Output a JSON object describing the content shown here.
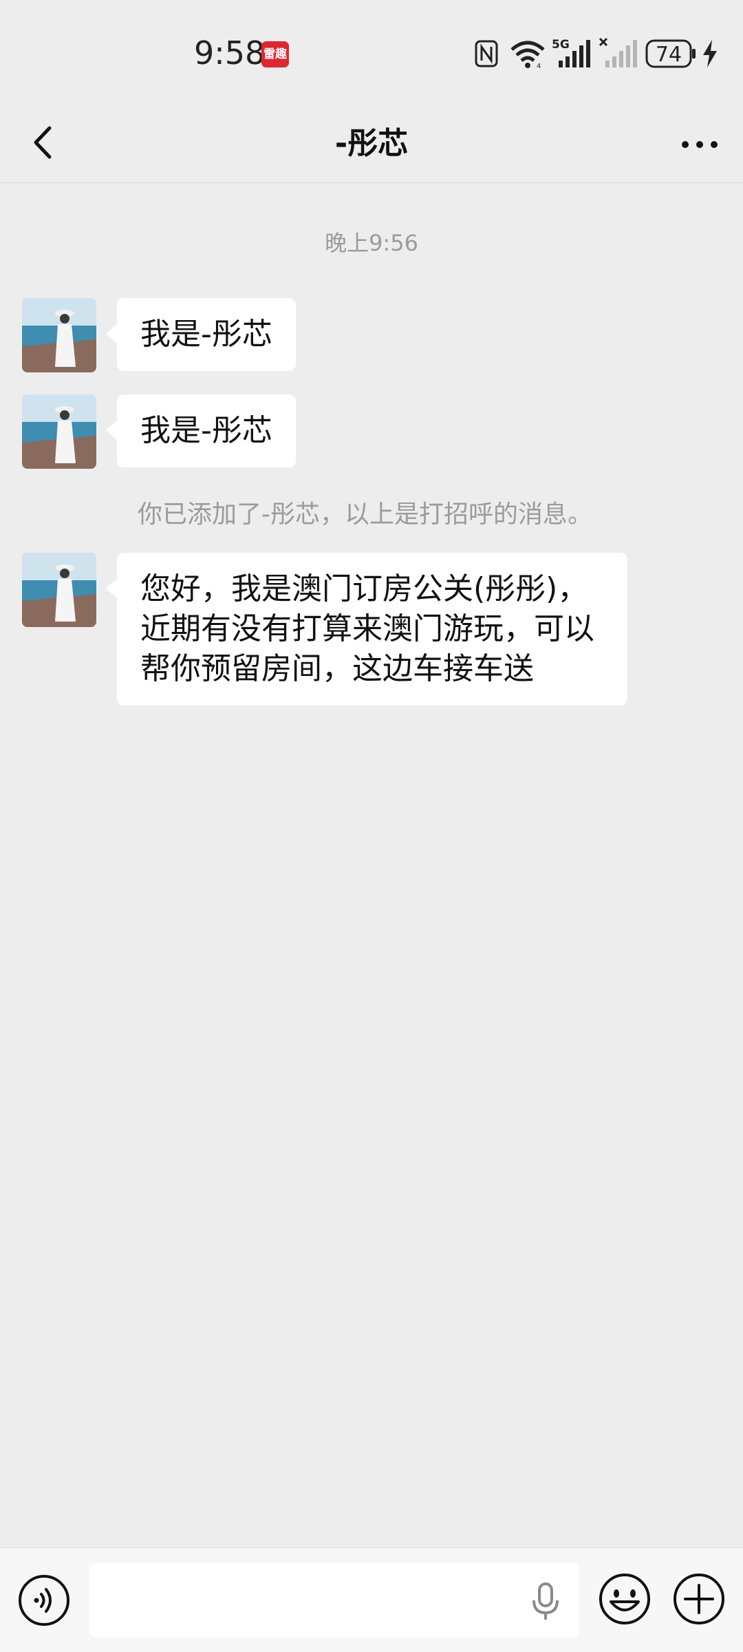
{
  "status_bar": {
    "time": "9:58",
    "app_badge": "雷趣",
    "network": "5G",
    "battery": "74",
    "icons": [
      "nfc-icon",
      "wifi-icon",
      "signal-5g-icon",
      "signal-no-sim-icon",
      "battery-icon",
      "charging-icon"
    ]
  },
  "nav": {
    "title": "-彤芯",
    "back_icon": "chevron-left-icon",
    "more_icon": "more-dots-icon"
  },
  "chat": {
    "timestamp": "晚上9:56",
    "messages": [
      {
        "text": "我是-彤芯"
      },
      {
        "text": "我是-彤芯"
      }
    ],
    "system_note": "你已添加了-彤芯，以上是打招呼的消息。",
    "long_message": {
      "line1": "您好，我是澳门订房公关(彤彤)，",
      "line2": "近期有没有打算来澳门游玩，可以",
      "line3": "帮你预留房间，这边车接车送"
    }
  },
  "input_bar": {
    "voice_icon": "voice-mode-icon",
    "input_value": "",
    "mic_icon": "microphone-icon",
    "emoji_icon": "emoji-icon",
    "plus_icon": "plus-circle-icon"
  },
  "colors": {
    "background": "#ededed",
    "bubble": "#ffffff",
    "muted_text": "#9b9b9b",
    "badge_red": "#e0262f"
  }
}
